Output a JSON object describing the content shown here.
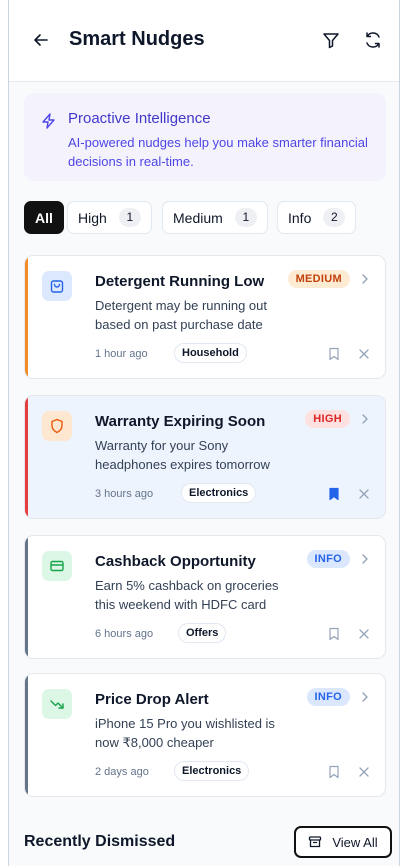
{
  "header": {
    "title": "Smart Nudges"
  },
  "banner": {
    "title": "Proactive Intelligence",
    "text": "AI-powered nudges help you make smarter financial decisions in real-time."
  },
  "filters": [
    {
      "label": "All",
      "count": ""
    },
    {
      "label": "High",
      "count": "1"
    },
    {
      "label": "Medium",
      "count": "1"
    },
    {
      "label": "Info",
      "count": "2"
    }
  ],
  "nudges": [
    {
      "title": "Detergent Running Low",
      "desc": "Detergent may be running out based on past purchase date",
      "priority": "MEDIUM",
      "time": "1 hour ago",
      "tag": "Household",
      "icon": "shopping-bag-icon",
      "accent": "#f28c2b",
      "bookmarked": false
    },
    {
      "title": "Warranty Expiring Soon",
      "desc": "Warranty for your Sony headphones expires tomorrow",
      "priority": "HIGH",
      "time": "3 hours ago",
      "tag": "Electronics",
      "icon": "shield-icon",
      "accent": "#e53e3e",
      "bookmarked": true
    },
    {
      "title": "Cashback Opportunity",
      "desc": "Earn 5% cashback on groceries this weekend with HDFC card",
      "priority": "INFO",
      "time": "6 hours ago",
      "tag": "Offers",
      "icon": "credit-card-icon",
      "accent": "#64748b",
      "bookmarked": false
    },
    {
      "title": "Price Drop Alert",
      "desc": "iPhone 15 Pro you wishlisted is now ₹8,000 cheaper",
      "priority": "INFO",
      "time": "2 days ago",
      "tag": "Electronics",
      "icon": "trending-down-icon",
      "accent": "#64748b",
      "bookmarked": false
    }
  ],
  "dismissed": {
    "title": "Recently Dismissed",
    "view_all": "View All"
  },
  "colors": {
    "primary": "#4f46e5",
    "bookmark_active": "#2563eb",
    "high": "#dc2626",
    "medium": "#c2410c",
    "info": "#2563eb"
  }
}
